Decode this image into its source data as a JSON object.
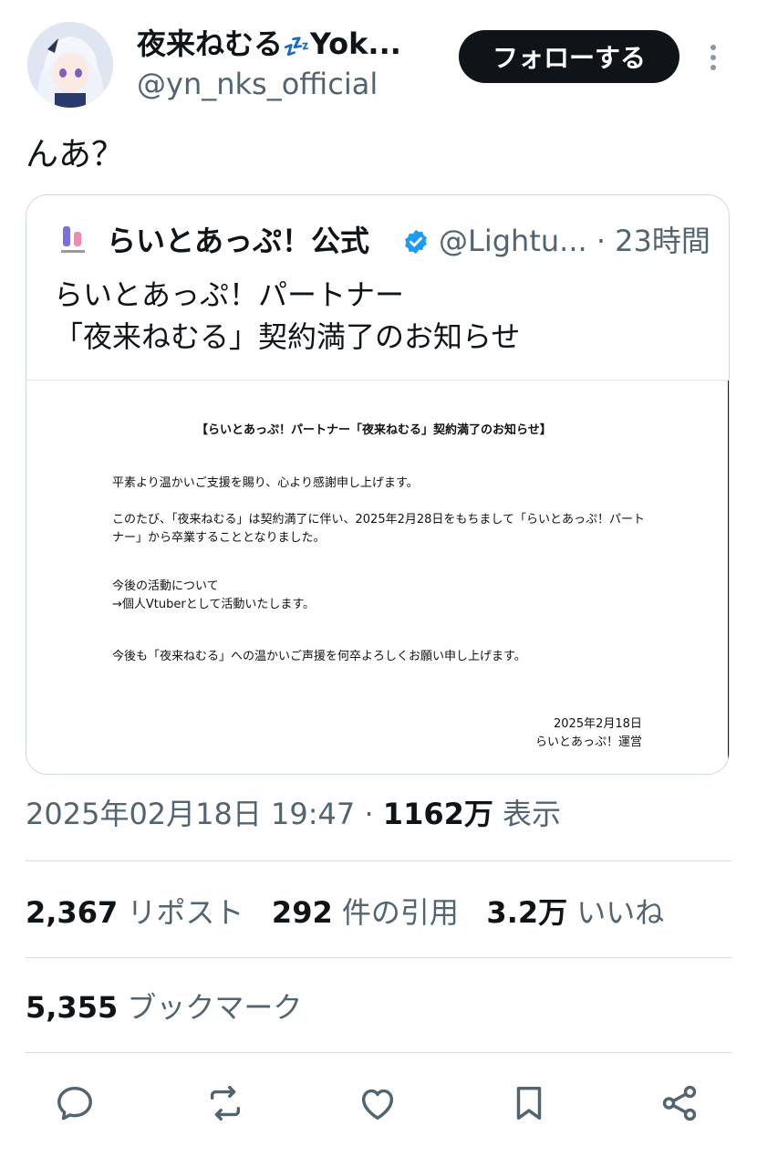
{
  "author": {
    "display_name": "夜来ねむる",
    "display_name_tail": "Yok...",
    "zz_emoji": "💤",
    "handle": "@yn_nks_official"
  },
  "follow_button": "フォローする",
  "tweet_text": "んあ？",
  "quote": {
    "name": "らいとあっぷ！公式",
    "handle_time": "@Lightu... · 23時間",
    "line1": "らいとあっぷ！パートナー",
    "line2": "「夜来ねむる」契約満了のお知らせ",
    "doc": {
      "title": "【らいとあっぷ！パートナー「夜来ねむる」契約満了のお知らせ】",
      "p1": "平素より温かいご支援を賜り、心より感謝申し上げます。",
      "p2a": "このたび、「夜来ねむる」は契約満了に伴い、2025年2月28日をもちまして「らいとあっぷ！パート",
      "p2b": "ナー」から卒業することとなりました。",
      "p3a": "今後の活動について",
      "p3b": "→個人Vtuberとして活動いたします。",
      "p4": "今後も「夜来ねむる」への温かいご声援を何卒よろしくお願い申し上げます。",
      "date": "2025年2月18日",
      "sign": "らいとあっぷ！運営"
    }
  },
  "meta": {
    "timestamp": "2025年02月18日 19:47 · ",
    "views_count": "1162万",
    "views_label": " 表示"
  },
  "stats": {
    "reposts_count": "2,367",
    "reposts_label": " リポスト",
    "quotes_count": "292",
    "quotes_label": " 件の引用",
    "likes_count": "3.2万",
    "likes_label": " いいね",
    "bookmarks_count": "5,355",
    "bookmarks_label": " ブックマーク"
  },
  "colors": {
    "text": "#0f1419",
    "secondary": "#536471",
    "verified": "#1d9bf0",
    "follow_bg": "#0f1419"
  }
}
